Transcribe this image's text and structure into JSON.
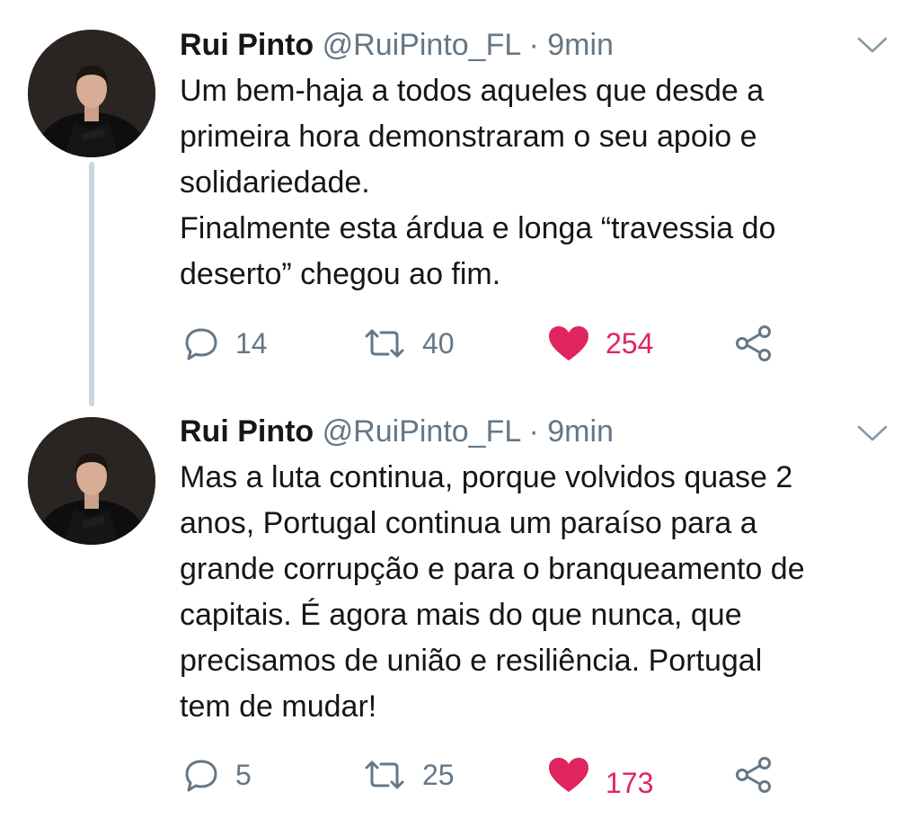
{
  "colors": {
    "like": "#e0245e",
    "muted": "#657786",
    "text": "#14171a",
    "thread": "#ccd6dd"
  },
  "tweets": [
    {
      "name": "Rui Pinto",
      "handle": "@RuiPinto_FL",
      "separator": "·",
      "time": "9min",
      "lines": [
        "Um bem-haja a todos aqueles que desde a",
        "primeira hora demonstraram o seu apoio e",
        "solidariedade.",
        "Finalmente esta árdua e longa “travessia do",
        "deserto” chegou ao fim."
      ],
      "replies": "14",
      "retweets": "40",
      "likes": "254",
      "liked": true
    },
    {
      "name": "Rui Pinto",
      "handle": "@RuiPinto_FL",
      "separator": "·",
      "time": "9min",
      "lines": [
        "Mas a luta continua, porque volvidos quase 2",
        "anos, Portugal continua um paraíso para a",
        "grande corrupção e para o branqueamento de",
        "capitais. É agora mais do que nunca, que",
        "precisamos de união e resiliência. Portugal",
        "tem de mudar!"
      ],
      "replies": "5",
      "retweets": "25",
      "likes": "173",
      "liked": true
    }
  ],
  "icons": {
    "reply": "reply-icon",
    "retweet": "retweet-icon",
    "like": "heart-icon",
    "share": "share-icon",
    "menu": "chevron-down-icon"
  }
}
